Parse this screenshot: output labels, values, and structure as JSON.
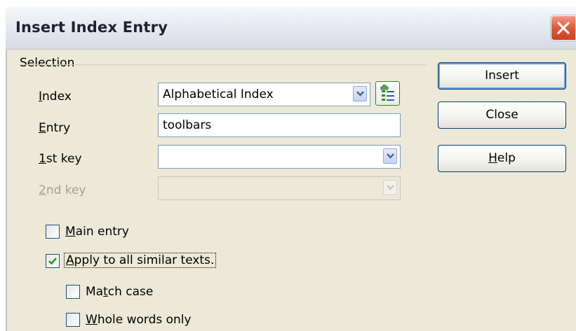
{
  "window": {
    "title": "Insert Index Entry"
  },
  "selection": {
    "group_label": "Selection",
    "index": {
      "label_accel": "I",
      "label_rest": "ndex",
      "value": "Alphabetical Index"
    },
    "entry": {
      "label_accel": "E",
      "label_rest": "ntry",
      "value": "toolbars"
    },
    "key1": {
      "label_accel": "1",
      "label_rest": "st key",
      "value": ""
    },
    "key2": {
      "label_accel": "2",
      "label_rest": "nd key",
      "value": "",
      "disabled": true
    },
    "main_entry": {
      "label_accel": "M",
      "label_rest": "ain entry",
      "checked": false
    },
    "apply_all": {
      "label_accel": "A",
      "label_rest": "pply to all similar texts.",
      "checked": true
    },
    "match_case": {
      "label_pre": "Ma",
      "label_accel": "t",
      "label_rest": "ch case",
      "checked": false
    },
    "whole_words": {
      "label_accel": "W",
      "label_rest": "hole words only",
      "checked": false
    }
  },
  "buttons": {
    "insert": "Insert",
    "close": "Close",
    "help_accel": "H",
    "help_rest": "elp"
  },
  "colors": {
    "dialog_bg": "#ece9d8",
    "button_border": "#003c74",
    "close_red": "#e0593c",
    "checkmark_green": "#21a121"
  },
  "icons": {
    "title_close": "close-icon",
    "new_index": "new-user-defined-index-icon",
    "dropdown": "chevron-down-icon",
    "checkmark": "checkmark-icon"
  }
}
